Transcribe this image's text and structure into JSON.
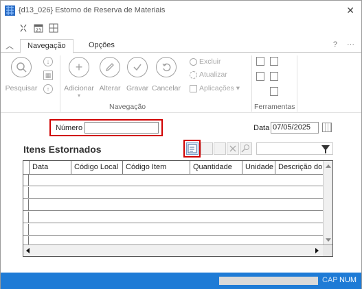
{
  "window": {
    "title": "{d13_026} Estorno de Reserva de Materiais",
    "close_glyph": "✕"
  },
  "tabs": [
    {
      "label": "Navegação",
      "active": true
    },
    {
      "label": "Opções",
      "active": false
    }
  ],
  "tab_help": "?",
  "tab_more": "···",
  "ribbon": {
    "buttons": {
      "pesquisar": "Pesquisar",
      "adicionar": "Adicionar",
      "alterar": "Alterar",
      "gravar": "Gravar",
      "cancelar": "Cancelar"
    },
    "small": {
      "excluir": "Excluir",
      "atualizar": "Atualizar",
      "aplicacoes": "Aplicações ▾"
    },
    "groups": {
      "navegacao": "Navegação",
      "ferramentas": "Ferramentas"
    },
    "adicionar_dropdown": "▾"
  },
  "form": {
    "numero_label": "Número",
    "numero_value": "",
    "data_label": "Data",
    "data_value": "07/05/2025"
  },
  "grid": {
    "title": "Itens Estornados",
    "search_value": "",
    "columns": [
      "Data",
      "Código Local",
      "Código Item",
      "Quantidade",
      "Unidade",
      "Descrição do"
    ]
  },
  "status": {
    "cap": "CAP",
    "num": "NUM"
  },
  "colors": {
    "status_bar": "#1e7bd6",
    "highlight": "#d00000"
  }
}
